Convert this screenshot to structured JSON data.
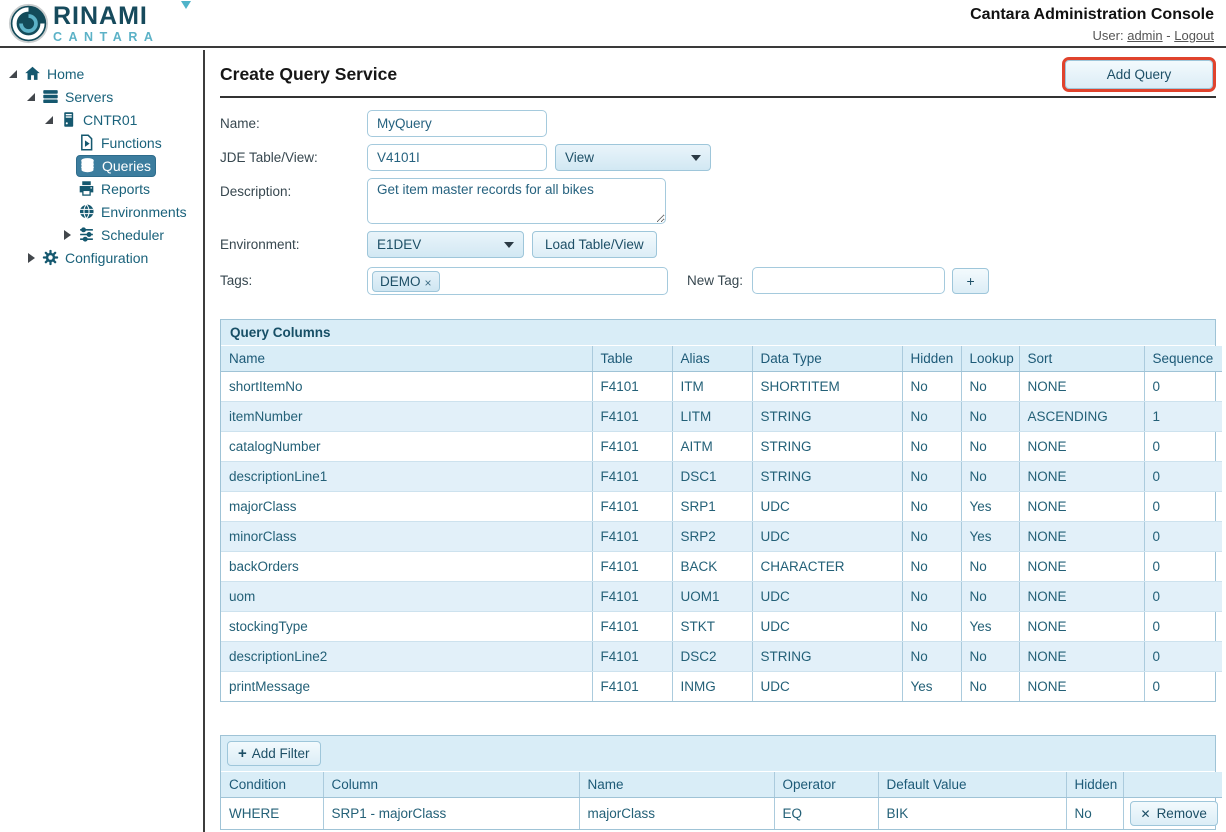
{
  "header": {
    "logo_primary": "RINAMI",
    "logo_secondary": "CANTARA",
    "title": "Cantara Administration Console",
    "user_label": "User:",
    "user_name": "admin",
    "separator": "-",
    "logout_label": "Logout"
  },
  "sidebar": {
    "items": [
      {
        "label": "Home",
        "icon": "home-icon",
        "level": 0,
        "arrow": "expanded",
        "selected": false
      },
      {
        "label": "Servers",
        "icon": "servers-icon",
        "level": 1,
        "arrow": "expanded",
        "selected": false
      },
      {
        "label": "CNTR01",
        "icon": "server-icon",
        "level": 2,
        "arrow": "expanded",
        "selected": false
      },
      {
        "label": "Functions",
        "icon": "functions-icon",
        "level": 3,
        "arrow": null,
        "selected": false
      },
      {
        "label": "Queries",
        "icon": "queries-icon",
        "level": 3,
        "arrow": null,
        "selected": true
      },
      {
        "label": "Reports",
        "icon": "reports-icon",
        "level": 3,
        "arrow": null,
        "selected": false
      },
      {
        "label": "Environments",
        "icon": "environments-icon",
        "level": 3,
        "arrow": null,
        "selected": false
      },
      {
        "label": "Scheduler",
        "icon": "scheduler-icon",
        "level": 3,
        "arrow": "collapsed",
        "selected": false
      },
      {
        "label": "Configuration",
        "icon": "configuration-icon",
        "level": 1,
        "arrow": "collapsed",
        "selected": false
      }
    ]
  },
  "main": {
    "page_title": "Create Query Service",
    "add_query_button": "Add Query",
    "form": {
      "name_label": "Name:",
      "name_value": "MyQuery",
      "table_label": "JDE Table/View:",
      "table_value": "V4101I",
      "table_type_selected": "View",
      "description_label": "Description:",
      "description_value": "Get item master records for all bikes",
      "environment_label": "Environment:",
      "environment_selected": "E1DEV",
      "load_button": "Load Table/View",
      "tags_label": "Tags:",
      "tags": [
        "DEMO"
      ],
      "tag_remove_glyph": "×",
      "new_tag_label": "New Tag:",
      "new_tag_value": "",
      "add_tag_button": "+"
    },
    "query_columns": {
      "title": "Query Columns",
      "headers": [
        "Name",
        "Table",
        "Alias",
        "Data Type",
        "Hidden",
        "Lookup",
        "Sort",
        "Sequence"
      ],
      "rows": [
        [
          "shortItemNo",
          "F4101",
          "ITM",
          "SHORTITEM",
          "No",
          "No",
          "NONE",
          "0"
        ],
        [
          "itemNumber",
          "F4101",
          "LITM",
          "STRING",
          "No",
          "No",
          "ASCENDING",
          "1"
        ],
        [
          "catalogNumber",
          "F4101",
          "AITM",
          "STRING",
          "No",
          "No",
          "NONE",
          "0"
        ],
        [
          "descriptionLine1",
          "F4101",
          "DSC1",
          "STRING",
          "No",
          "No",
          "NONE",
          "0"
        ],
        [
          "majorClass",
          "F4101",
          "SRP1",
          "UDC",
          "No",
          "Yes",
          "NONE",
          "0"
        ],
        [
          "minorClass",
          "F4101",
          "SRP2",
          "UDC",
          "No",
          "Yes",
          "NONE",
          "0"
        ],
        [
          "backOrders",
          "F4101",
          "BACK",
          "CHARACTER",
          "No",
          "No",
          "NONE",
          "0"
        ],
        [
          "uom",
          "F4101",
          "UOM1",
          "UDC",
          "No",
          "No",
          "NONE",
          "0"
        ],
        [
          "stockingType",
          "F4101",
          "STKT",
          "UDC",
          "No",
          "Yes",
          "NONE",
          "0"
        ],
        [
          "descriptionLine2",
          "F4101",
          "DSC2",
          "STRING",
          "No",
          "No",
          "NONE",
          "0"
        ],
        [
          "printMessage",
          "F4101",
          "INMG",
          "UDC",
          "Yes",
          "No",
          "NONE",
          "0"
        ]
      ]
    },
    "filters": {
      "add_filter_plus": "+",
      "add_filter_button": "Add Filter",
      "headers": [
        "Condition",
        "Column",
        "Name",
        "Operator",
        "Default Value",
        "Hidden",
        ""
      ],
      "rows": [
        {
          "cells": [
            "WHERE",
            "SRP1 - majorClass",
            "majorClass",
            "EQ",
            "BIK",
            "No"
          ],
          "remove_glyph": "✕",
          "remove_button": "Remove"
        }
      ]
    }
  },
  "colors": {
    "selected_tree_item_bg": "#3c7d9e",
    "panel_header_bg": "#d9edf7",
    "row_alt_bg": "#e2f0f9",
    "highlight_border": "#e0432d",
    "logo_dark_teal": "#164a5c",
    "logo_light_teal": "#5cb2c7",
    "table_text": "#236077"
  }
}
